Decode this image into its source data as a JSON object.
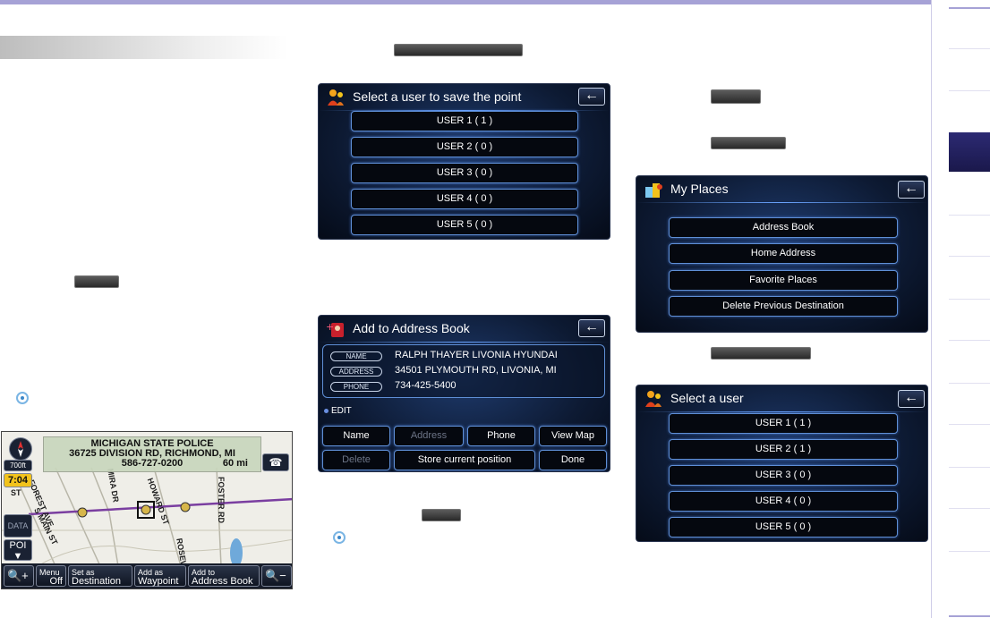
{
  "save_point_screen": {
    "title": "Select a user to save the point",
    "users": [
      "USER 1 ( 1 )",
      "USER 2 ( 0 )",
      "USER 3 ( 0 )",
      "USER 4 ( 0 )",
      "USER 5 ( 0 )"
    ]
  },
  "address_book_screen": {
    "title": "Add to Address Book",
    "name_label": "NAME",
    "name_value": "RALPH THAYER LIVONIA HYUNDAI",
    "address_label": "ADDRESS",
    "address_value": "34501 PLYMOUTH RD, LIVONIA, MI",
    "phone_label": "PHONE",
    "phone_value": "734-425-5400",
    "edit_label": "EDIT",
    "buttons_row1": [
      "Name",
      "Address",
      "Phone",
      "View Map"
    ],
    "buttons_row2": [
      "Delete",
      "Store current position",
      "Done"
    ]
  },
  "my_places_screen": {
    "title": "My Places",
    "items": [
      "Address Book",
      "Home Address",
      "Favorite Places",
      "Delete Previous Destination"
    ]
  },
  "select_user_screen": {
    "title": "Select a user",
    "users": [
      "USER 1 ( 1 )",
      "USER 2 ( 1 )",
      "USER 3 ( 0 )",
      "USER 4 ( 0 )",
      "USER 5 ( 0 )"
    ]
  },
  "map_screen": {
    "poi_name": "MICHIGAN STATE POLICE",
    "poi_address": "36725 DIVISION RD, RICHMOND, MI",
    "poi_phone": "586-727-0200",
    "poi_distance": "60 mi",
    "scale": "700ft",
    "time": "7:04",
    "data_label": "DATA",
    "poi_button": "POI",
    "roads": [
      "FOREST AVE",
      "S MAIN ST",
      "HOWARD ST",
      "FOSTER RD",
      "MIRA DR",
      "ROSEW",
      "ST"
    ],
    "bottom_buttons": [
      {
        "small": "Menu",
        "big": "Off"
      },
      {
        "small": "Set as",
        "big": "Destination"
      },
      {
        "small": "Add as",
        "big": "Waypoint"
      },
      {
        "small": "Add to",
        "big": "Address Book"
      }
    ]
  },
  "colors": {
    "accent_bar": "#a6a2d6",
    "side_tab": "#2c2a73",
    "screen_bg": "#0d1a33",
    "button_border": "#5f8fd6"
  }
}
